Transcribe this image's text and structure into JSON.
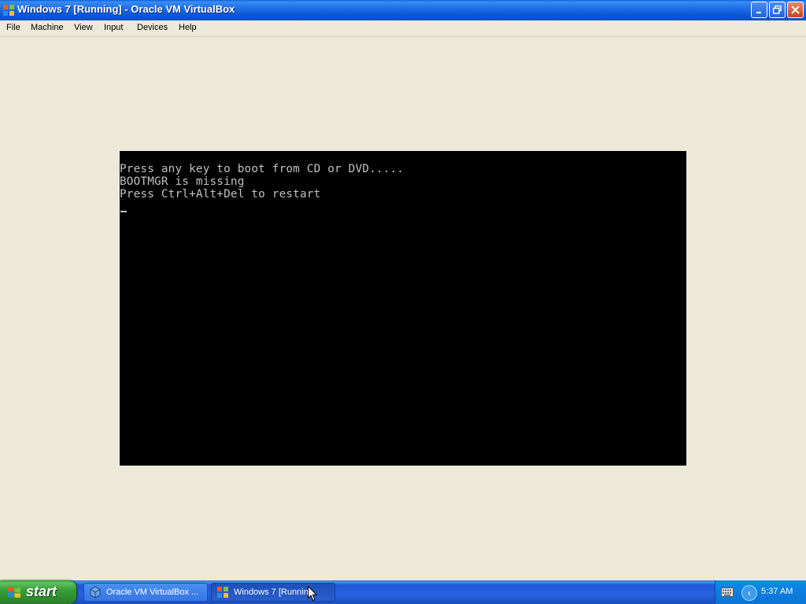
{
  "window": {
    "title": "Windows 7 [Running] - Oracle VM VirtualBox",
    "controls": [
      "minimize",
      "restore",
      "close"
    ]
  },
  "menubar": {
    "items": [
      "File",
      "Machine",
      "View",
      "Input",
      "Devices",
      "Help"
    ]
  },
  "console": {
    "lines": [
      "Press any key to boot from CD or DVD.....",
      "BOOTMGR is missing",
      "Press Ctrl+Alt+Del to restart"
    ],
    "cursor": "_"
  },
  "taskbar": {
    "start_label": "start",
    "tasks": [
      {
        "label": "Oracle VM VirtualBox ...",
        "icon": "virtualbox-icon",
        "active": false
      },
      {
        "label": "Windows 7 [Runnin...",
        "icon": "windows-flag-icon",
        "active": true
      }
    ],
    "tray": {
      "icons": [
        "keyboard-icon",
        "tray-chevron-icon"
      ],
      "clock": "5:37 AM"
    }
  },
  "colors": {
    "titlebar": "#0c58d6",
    "workspace": "#ece9d8",
    "vm_screen": "#000000",
    "console_text": "#c0c0c0",
    "start_button": "#37a037",
    "taskbar": "#2663e0",
    "tray": "#0a73d4"
  }
}
